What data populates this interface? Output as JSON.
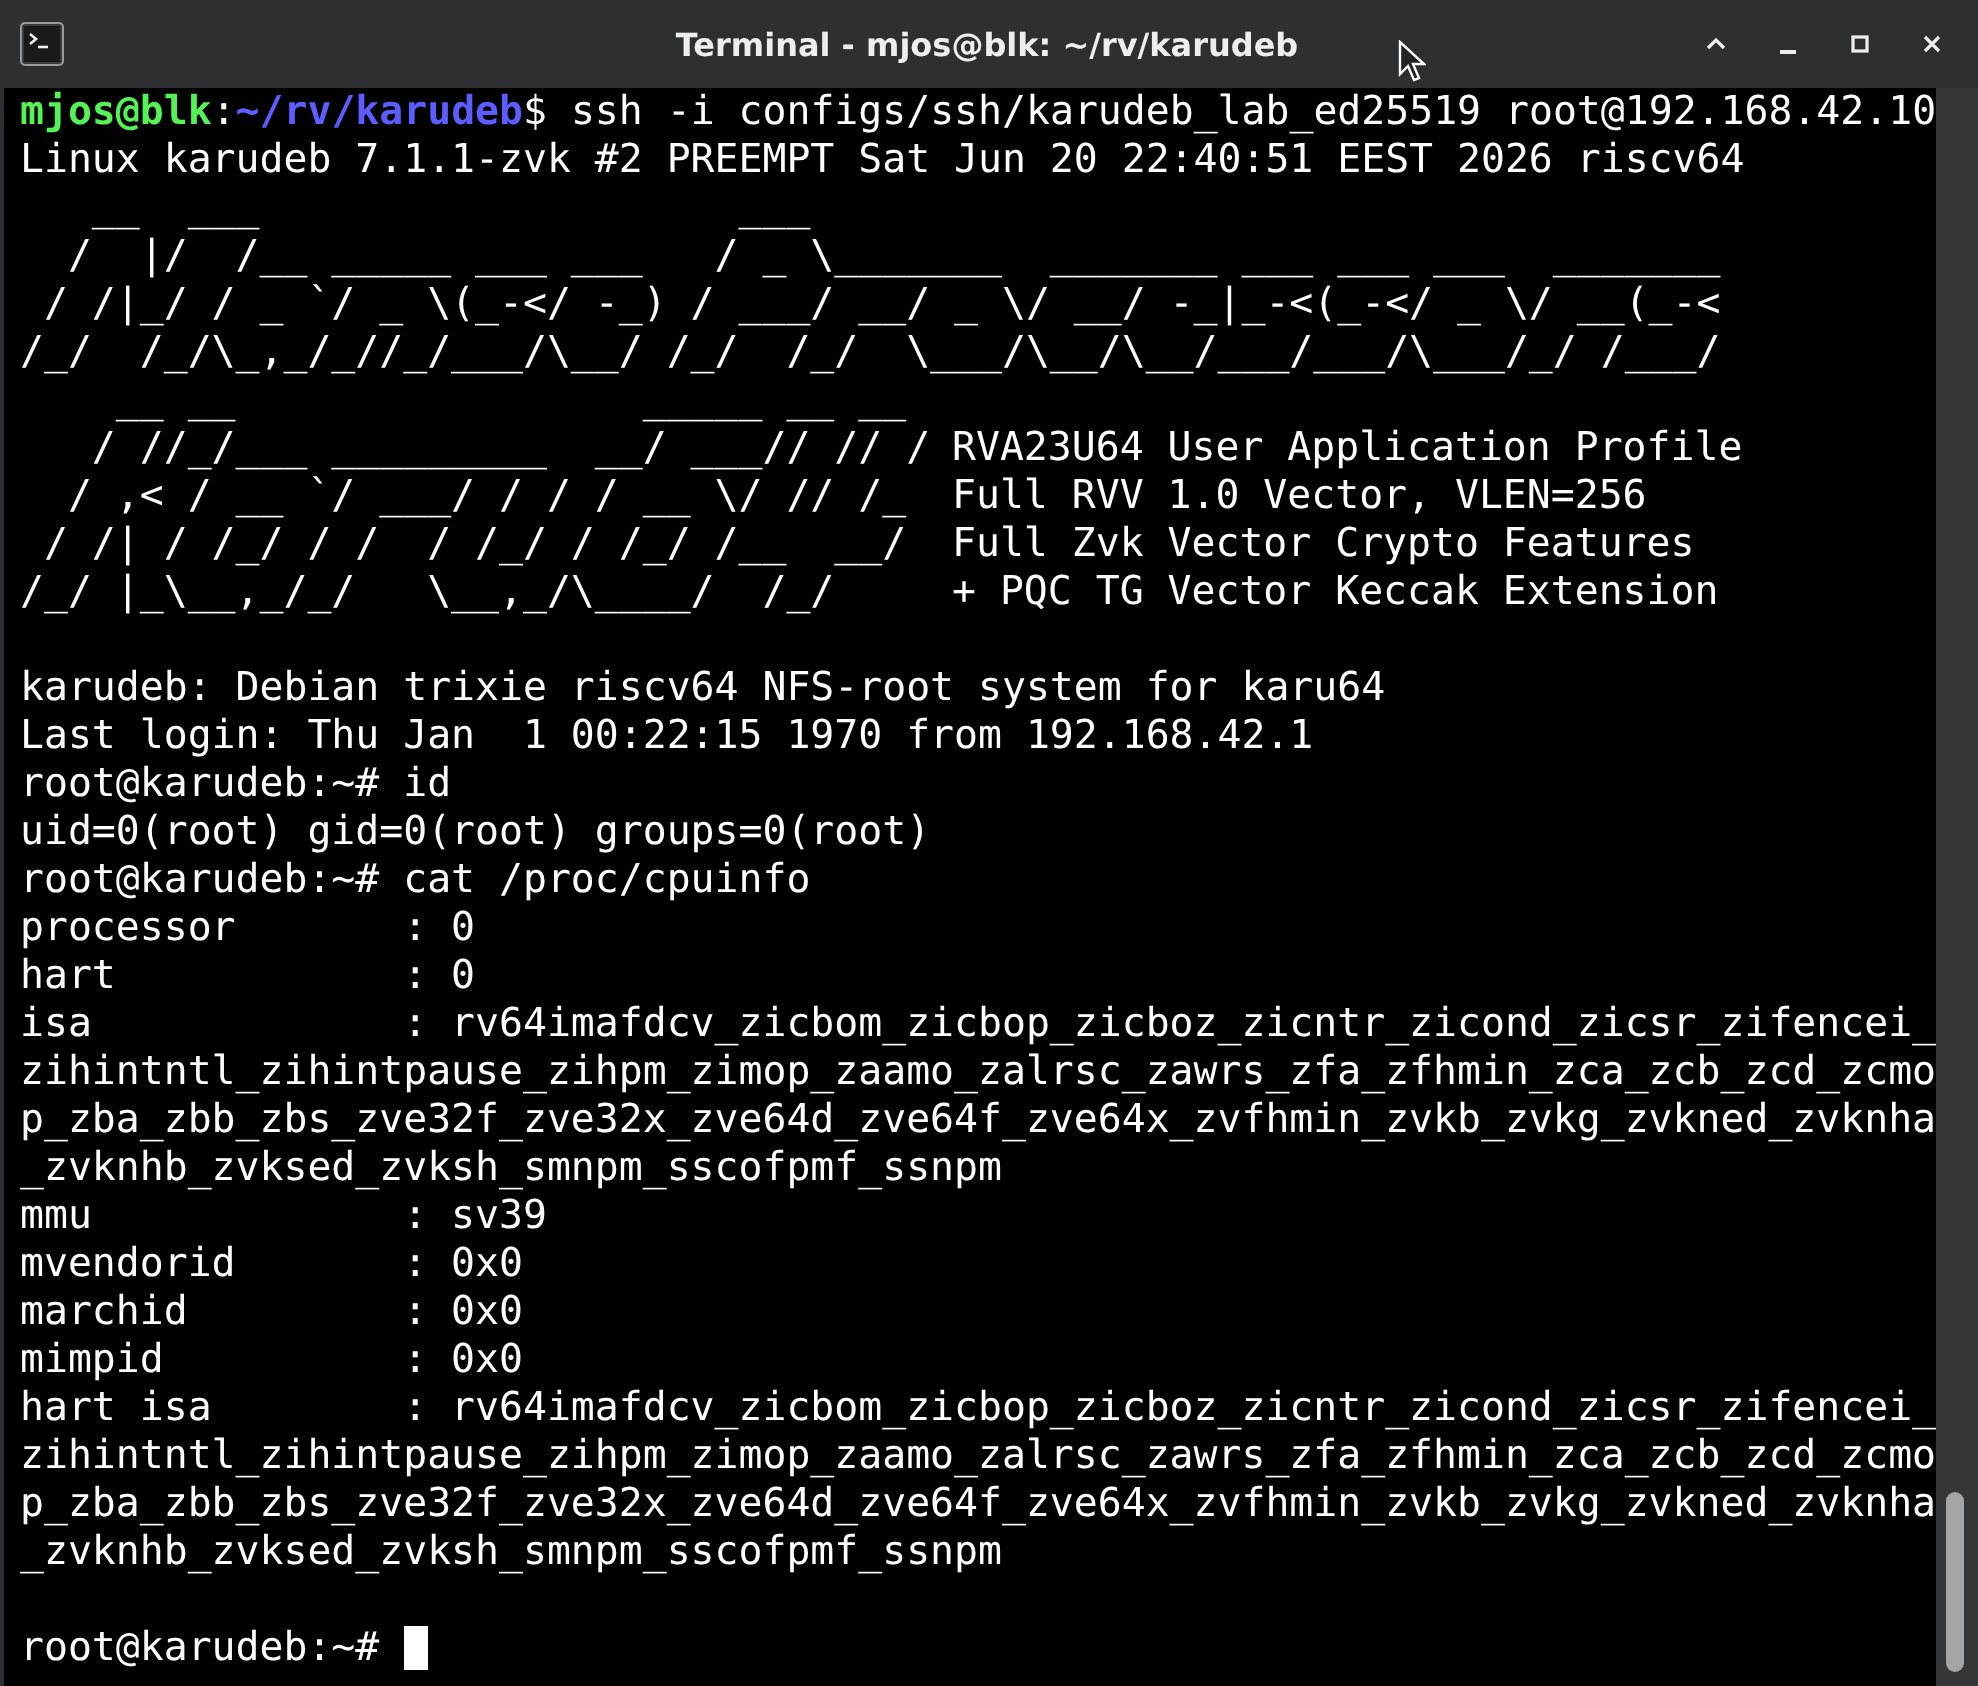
{
  "window": {
    "title": "Terminal - mjos@blk: ~/rv/karudeb"
  },
  "terminal": {
    "lines": [
      {
        "kind": "prompt",
        "user_host": "mjos@blk",
        "separator": ":",
        "path": "~/rv/karudeb",
        "symbol": "$",
        "command": " ssh -i configs/ssh/karudeb_lab_ed25519 root@192.168.42.10"
      },
      {
        "kind": "text",
        "text": "Linux karudeb 7.1.1-zvk #2 PREEMPT Sat Jun 20 22:40:51 EEST 2026 riscv64"
      },
      {
        "kind": "art",
        "text": "   __  ___                    ___"
      },
      {
        "kind": "art",
        "text": "  /  |/  /__ _____ ___ ___   / _ \\_______  _______ ___ ___ ___  _______"
      },
      {
        "kind": "art",
        "text": " / /|_/ / _ `/ _ \\(_-</ -_) / ___/ __/ _ \\/ __/ -_|_-<(_-</ _ \\/ __(_-<"
      },
      {
        "kind": "art",
        "text": "/_/  /_/\\_,_/_//_/___/\\__/ /_/  /_/  \\___/\\__/\\__/___/___/\\___/_/ /___/"
      },
      {
        "kind": "art",
        "text": "    __ __                 _____ __ __"
      },
      {
        "kind": "art",
        "text": "   / //_/___ _________  __/ ___// // /",
        "note": "RVA23U64 User Application Profile"
      },
      {
        "kind": "art",
        "text": "  / ,< / __ `/ ___/ / / / __ \\/ // /_",
        "note": "Full RVV 1.0 Vector, VLEN=256"
      },
      {
        "kind": "art",
        "text": " / /| / /_/ / /  / /_/ / /_/ /__  __/",
        "note": "Full Zvk Vector Crypto Features"
      },
      {
        "kind": "art",
        "text": "/_/ |_\\__,_/_/   \\__,_/\\____/  /_/",
        "note": "+ PQC TG Vector Keccak Extension"
      },
      {
        "kind": "blank"
      },
      {
        "kind": "text",
        "text": "karudeb: Debian trixie riscv64 NFS-root system for karu64"
      },
      {
        "kind": "text",
        "text": "Last login: Thu Jan  1 00:22:15 1970 from 192.168.42.1"
      },
      {
        "kind": "text",
        "text": "root@karudeb:~# id"
      },
      {
        "kind": "text",
        "text": "uid=0(root) gid=0(root) groups=0(root)"
      },
      {
        "kind": "text",
        "text": "root@karudeb:~# cat /proc/cpuinfo"
      },
      {
        "kind": "text",
        "text": "processor       : 0"
      },
      {
        "kind": "text",
        "text": "hart            : 0"
      },
      {
        "kind": "text",
        "text": "isa             : rv64imafdcv_zicbom_zicbop_zicboz_zicntr_zicond_zicsr_zifencei_"
      },
      {
        "kind": "text",
        "text": "zihintntl_zihintpause_zihpm_zimop_zaamo_zalrsc_zawrs_zfa_zfhmin_zca_zcb_zcd_zcmo"
      },
      {
        "kind": "text",
        "text": "p_zba_zbb_zbs_zve32f_zve32x_zve64d_zve64f_zve64x_zvfhmin_zvkb_zvkg_zvkned_zvknha"
      },
      {
        "kind": "text",
        "text": "_zvknhb_zvksed_zvksh_smnpm_sscofpmf_ssnpm"
      },
      {
        "kind": "text",
        "text": "mmu             : sv39"
      },
      {
        "kind": "text",
        "text": "mvendorid       : 0x0"
      },
      {
        "kind": "text",
        "text": "marchid         : 0x0"
      },
      {
        "kind": "text",
        "text": "mimpid          : 0x0"
      },
      {
        "kind": "text",
        "text": "hart isa        : rv64imafdcv_zicbom_zicbop_zicboz_zicntr_zicond_zicsr_zifencei_"
      },
      {
        "kind": "text",
        "text": "zihintntl_zihintpause_zihpm_zimop_zaamo_zalrsc_zawrs_zfa_zfhmin_zca_zcb_zcd_zcmo"
      },
      {
        "kind": "text",
        "text": "p_zba_zbb_zbs_zve32f_zve32x_zve64d_zve64f_zve64x_zvfhmin_zvkb_zvkg_zvkned_zvknha"
      },
      {
        "kind": "text",
        "text": "_zvknhb_zvksed_zvksh_smnpm_sscofpmf_ssnpm"
      },
      {
        "kind": "blank"
      },
      {
        "kind": "text",
        "text": "root@karudeb:~#",
        "cursor": true
      }
    ]
  }
}
